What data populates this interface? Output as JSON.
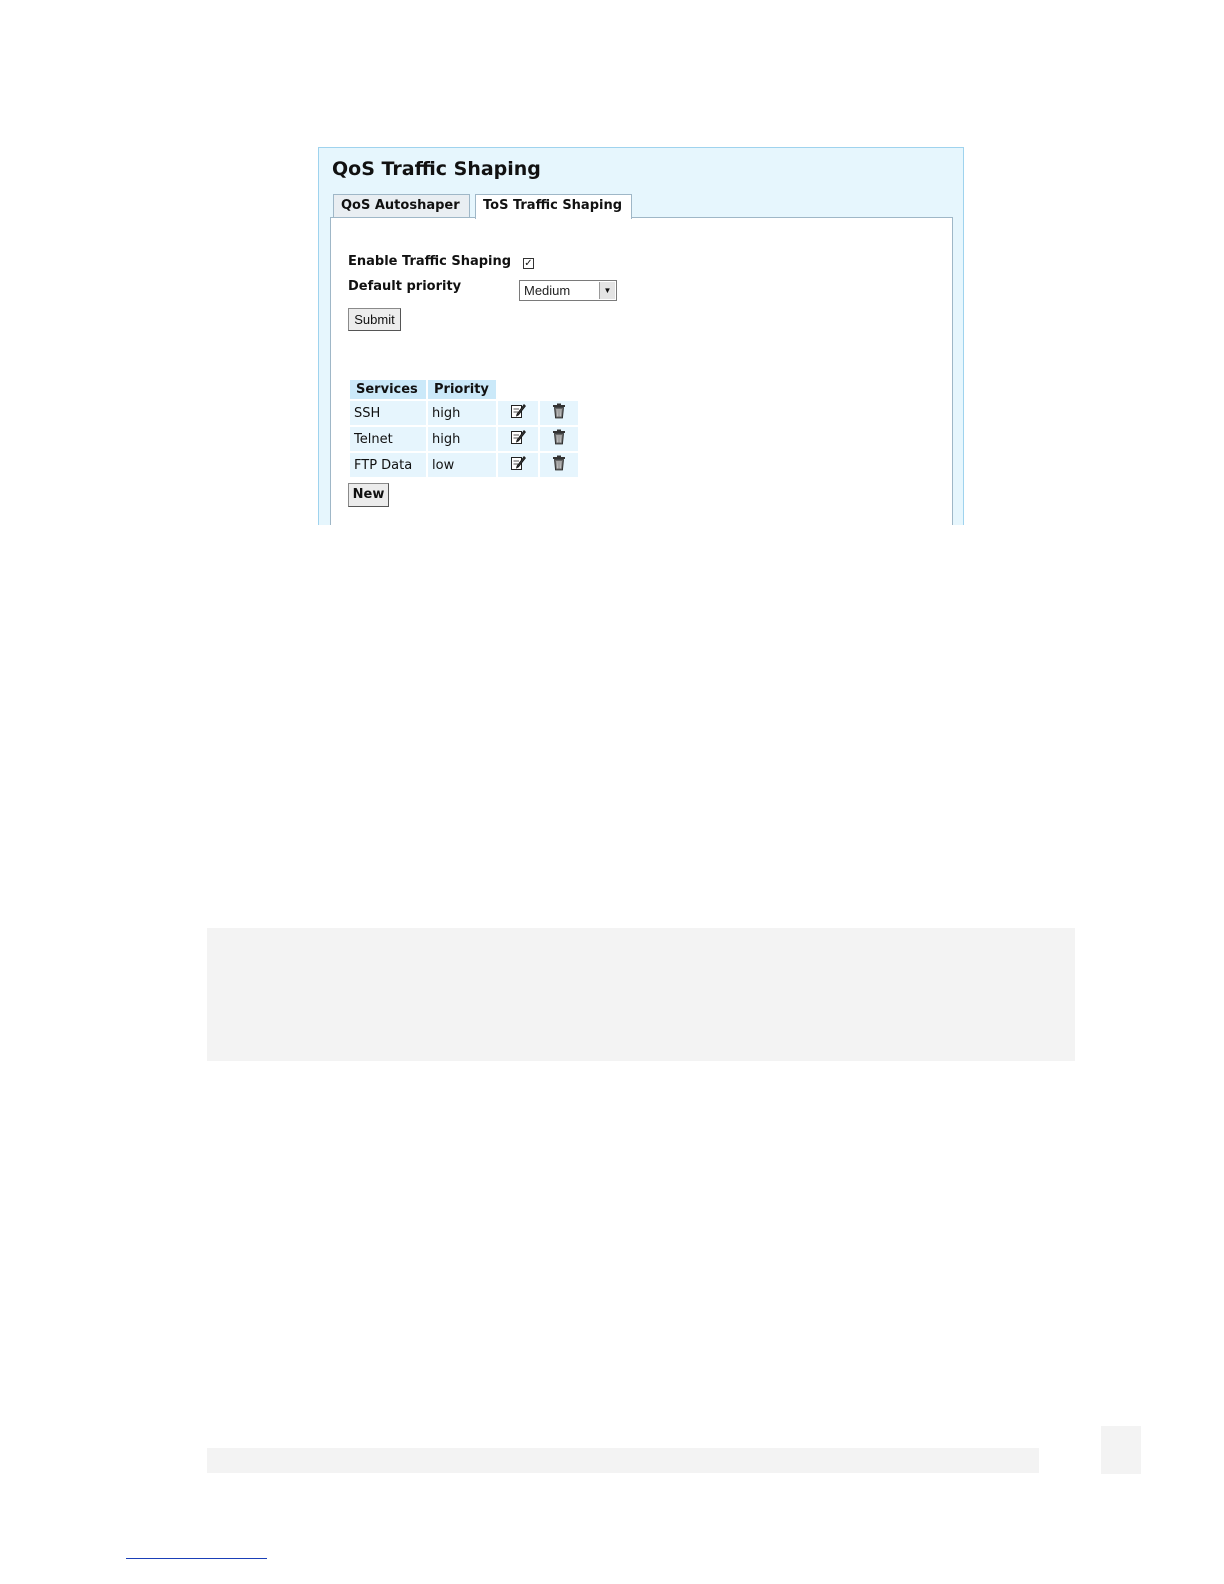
{
  "page": {
    "title": "QoS Traffic Shaping"
  },
  "tabs": [
    {
      "label": "QoS Autoshaper",
      "active": false
    },
    {
      "label": "ToS Traffic Shaping",
      "active": true
    }
  ],
  "form": {
    "enable_label": "Enable Traffic Shaping",
    "enable_checked": "✓",
    "default_priority_label": "Default priority",
    "default_priority_value": "Medium",
    "submit_label": "Submit"
  },
  "table": {
    "headers": [
      "Services",
      "Priority"
    ],
    "rows": [
      {
        "service": "SSH",
        "priority": "high"
      },
      {
        "service": "Telnet",
        "priority": "high"
      },
      {
        "service": "FTP Data",
        "priority": "low"
      }
    ],
    "row_icons": [
      "edit-icon",
      "trash-icon"
    ]
  },
  "new_label": "New",
  "colors": {
    "panel_background": "#e6f6fd",
    "header_cell": "#cbe9f9",
    "data_cell": "#e6f5fd"
  }
}
